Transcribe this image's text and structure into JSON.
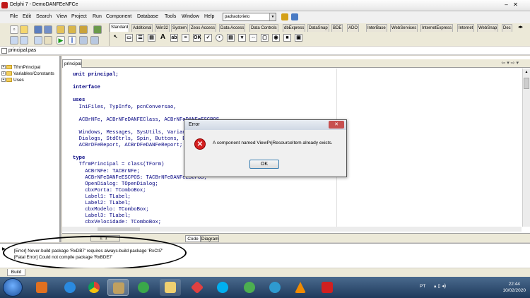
{
  "window": {
    "title": "Delphi 7 - DemoDANFEeNFCe"
  },
  "menu": {
    "items": [
      "File",
      "Edit",
      "Search",
      "View",
      "Project",
      "Run",
      "Component",
      "Database",
      "Tools",
      "Window",
      "Help"
    ],
    "project_combo": "padraotorieto"
  },
  "palette": {
    "tabs": [
      "Standard",
      "Additional",
      "Win32",
      "System",
      "Zeos Access",
      "Data Access",
      "Data Controls",
      "dbExpress",
      "DataSnap",
      "BDE",
      "ADO",
      "InterBase",
      "WebServices",
      "InternetExpress",
      "Internet",
      "WebSnap",
      "Dec"
    ],
    "active_tab": "Standard"
  },
  "file_tab": {
    "label": "principal.pas"
  },
  "explorer": {
    "items": [
      {
        "label": "TfrmPrincipal",
        "expand": "+"
      },
      {
        "label": "Variables/Constants",
        "expand": "+"
      },
      {
        "label": "Uses",
        "expand": "+"
      }
    ]
  },
  "editor": {
    "tab": "principal",
    "code_lines": [
      {
        "text": "unit principal;",
        "kw": true
      },
      {
        "text": "",
        "kw": false
      },
      {
        "text": "interface",
        "kw": true
      },
      {
        "text": "",
        "kw": false
      },
      {
        "text": "uses",
        "kw": true
      },
      {
        "text": "  IniFiles, TypInfo, pcnConversao,",
        "kw": false
      },
      {
        "text": "",
        "kw": false
      },
      {
        "text": "  ACBrNFe, ACBrNFeDANFEClass, ACBrNFeDANFeESCPOS,",
        "kw": false
      },
      {
        "text": "",
        "kw": false
      },
      {
        "text": "  Windows, Messages, SysUtils, Variants, Classes, Graphics, Controls, Forms,",
        "kw": false
      },
      {
        "text": "  Dialogs, StdCtrls, Spin, Buttons, ExtCtrls, ComCtrls,",
        "kw": false
      },
      {
        "text": "  ACBrDFeReport, ACBrDFeDANFeReport;",
        "kw": false
      },
      {
        "text": "",
        "kw": false
      },
      {
        "text": "type",
        "kw": true
      },
      {
        "text": "  TfrmPrincipal = class(TForm)",
        "kw": false
      },
      {
        "text": "    ACBrNFe: TACBrNFe;",
        "kw": false
      },
      {
        "text": "    ACBrNFeDANFeESCPOS: TACBrNFeDANFeESCPOS;",
        "kw": false
      },
      {
        "text": "    OpenDialog: TOpenDialog;",
        "kw": false
      },
      {
        "text": "    cbxPorta: TComboBox;",
        "kw": false
      },
      {
        "text": "    Label1: TLabel;",
        "kw": false
      },
      {
        "text": "    Label2: TLabel;",
        "kw": false
      },
      {
        "text": "    cbxModelo: TComboBox;",
        "kw": false
      },
      {
        "text": "    Label3: TLabel;",
        "kw": false
      },
      {
        "text": "    cbxVelocidade: TComboBox;",
        "kw": false
      }
    ],
    "status_position": "1:  1",
    "view_tabs": [
      "Code",
      "Diagram"
    ]
  },
  "messages": {
    "lines": [
      "[Error] Never-build package 'RxDB7' requires always-build package 'RxCtl7'",
      "[Fatal Error] Could not compile package 'RxBDE7'"
    ],
    "tab": "Build"
  },
  "dialog": {
    "title": "Error",
    "close_glyph": "✕",
    "message": "A component named ViewPrjResourceItem already exists.",
    "ok_label": "OK"
  },
  "taskbar": {
    "language": "PT",
    "time": "22:44",
    "date": "10/02/2020"
  },
  "colors": {
    "code_text": "#000080",
    "error_red": "#d42020",
    "taskbar": "#2a4b73"
  }
}
